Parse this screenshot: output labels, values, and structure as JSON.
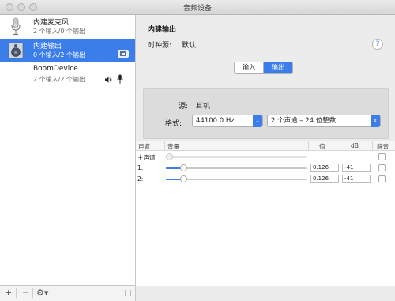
{
  "window": {
    "title": "音频设备"
  },
  "sidebar": {
    "devices": [
      {
        "name": "内建麦克风",
        "sub": "2 个输入/0 个输出",
        "icon": "microphone-icon",
        "selected": false
      },
      {
        "name": "内建输出",
        "sub": "0 个输入/2 个输出",
        "icon": "speaker-icon",
        "selected": true
      },
      {
        "name": "BoomDevice",
        "sub": "2 个输入/2 个输出",
        "icon": "virtual-device-icon",
        "selected": false
      }
    ],
    "bottom": {
      "add": "+",
      "remove": "−",
      "gear": "⚙▾"
    }
  },
  "detail": {
    "title": "内建输出",
    "clock_label": "时钟源:",
    "clock_value": "默认",
    "help": "?",
    "tabs": [
      {
        "label": "输入",
        "selected": false
      },
      {
        "label": "输出",
        "selected": true
      }
    ],
    "source_label": "源:",
    "source_value": "耳机",
    "format_label": "格式:",
    "sample_rate": "44100.0 Hz",
    "channel_format": "2 个声道 – 24 位整数"
  },
  "table": {
    "headers": {
      "channel": "声道",
      "volume": "音量",
      "value": "值",
      "db": "dB",
      "mute": "静音"
    },
    "rows": [
      {
        "label": "主声道",
        "level": 0.0,
        "value": "",
        "db": "",
        "muted": false,
        "enabled": false
      },
      {
        "label": "1:",
        "level": 0.126,
        "value": "0.126",
        "db": "-41",
        "muted": false,
        "enabled": true
      },
      {
        "label": "2:",
        "level": 0.126,
        "value": "0.126",
        "db": "-41",
        "muted": false,
        "enabled": true
      }
    ]
  },
  "colors": {
    "accent": "#3b7ee9",
    "annotation_line": "#b81e1e"
  }
}
